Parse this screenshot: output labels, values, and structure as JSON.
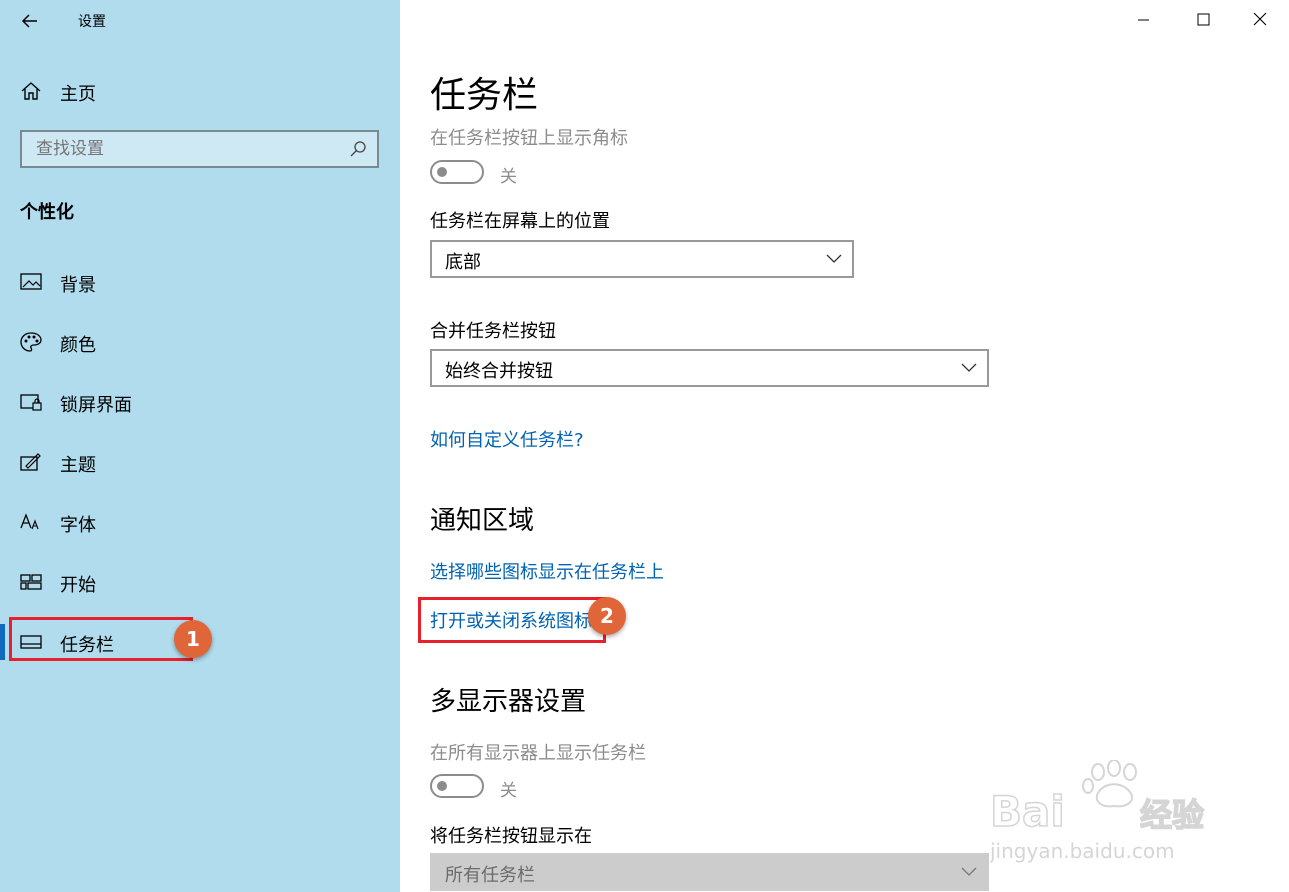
{
  "window": {
    "title": "设置"
  },
  "sidebar": {
    "home_label": "主页",
    "search_placeholder": "查找设置",
    "section_title": "个性化",
    "items": [
      {
        "label": "背景",
        "icon": "image-icon"
      },
      {
        "label": "颜色",
        "icon": "palette-icon"
      },
      {
        "label": "锁屏界面",
        "icon": "lock-screen-icon"
      },
      {
        "label": "主题",
        "icon": "theme-icon"
      },
      {
        "label": "字体",
        "icon": "font-icon"
      },
      {
        "label": "开始",
        "icon": "start-icon"
      },
      {
        "label": "任务栏",
        "icon": "taskbar-icon",
        "selected": true
      }
    ]
  },
  "main": {
    "title": "任务栏",
    "badges_label": "在任务栏按钮上显示角标",
    "badges_toggle": "关",
    "position_label": "任务栏在屏幕上的位置",
    "position_value": "底部",
    "combine_label": "合并任务栏按钮",
    "combine_value": "始终合并按钮",
    "customize_link": "如何自定义任务栏?",
    "notification_heading": "通知区域",
    "select_icons_link": "选择哪些图标显示在任务栏上",
    "system_icons_link": "打开或关闭系统图标",
    "multi_heading": "多显示器设置",
    "multi_show_label": "在所有显示器上显示任务栏",
    "multi_show_toggle": "关",
    "multi_buttons_label": "将任务栏按钮显示在",
    "multi_buttons_value": "所有任务栏"
  },
  "annotations": {
    "badge1": "1",
    "badge2": "2"
  },
  "watermark": {
    "brand": "Bai du 经验",
    "url": "jingyan.baidu.com"
  },
  "colors": {
    "sidebar_bg": "#b0dcee",
    "accent": "#0f6cbd",
    "link": "#0063b1",
    "highlight": "#e8202a",
    "badge": "#e0663a"
  }
}
